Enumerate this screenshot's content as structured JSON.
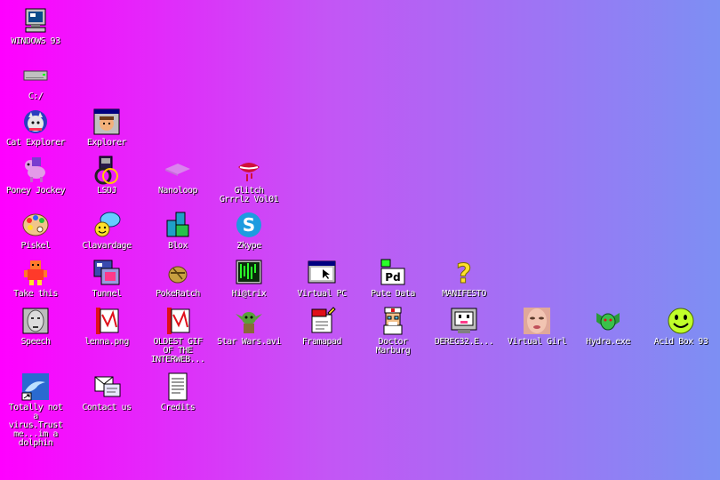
{
  "desktop": {
    "icons": [
      {
        "label": "WINDOWS 93",
        "icon": "computer-icon"
      },
      {
        "label": "C:/",
        "icon": "drive-icon"
      },
      {
        "label": "Cat Explorer",
        "icon": "cat-explorer-icon"
      },
      {
        "label": "Explorer",
        "icon": "explorer-icon"
      },
      {
        "label": "Poney Jockey",
        "icon": "pony-icon"
      },
      {
        "label": "LSDJ",
        "icon": "lsdj-icon"
      },
      {
        "label": "Nanoloop",
        "icon": "nanoloop-icon"
      },
      {
        "label": "Glitch Grrrlz Vol01",
        "icon": "glitch-lips-icon"
      },
      {
        "label": "Piskel",
        "icon": "palette-icon"
      },
      {
        "label": "Clavardage",
        "icon": "chat-icon"
      },
      {
        "label": "Blox",
        "icon": "blox-icon"
      },
      {
        "label": "Zkype",
        "icon": "zkype-icon"
      },
      {
        "label": "Take this",
        "icon": "pixel-character-icon"
      },
      {
        "label": "Tunnel",
        "icon": "tunnel-icon"
      },
      {
        "label": "PokeRatch",
        "icon": "poke-icon"
      },
      {
        "label": "Hi@trix",
        "icon": "matrix-icon"
      },
      {
        "label": "Virtual PC",
        "icon": "virtual-pc-icon"
      },
      {
        "label": "Pute Data",
        "icon": "pure-data-icon"
      },
      {
        "label": "MANIFESTO",
        "icon": "question-mark-icon"
      },
      {
        "label": "Speech",
        "icon": "face-speech-icon"
      },
      {
        "label": "lenna.png",
        "icon": "image-file-icon"
      },
      {
        "label": "OLDEST GIF OF THE INTERWEB...",
        "icon": "gif-file-icon"
      },
      {
        "label": "Star Wars.avi",
        "icon": "yoda-icon"
      },
      {
        "label": "Framapad",
        "icon": "framapad-icon"
      },
      {
        "label": "Doctor Marburg",
        "icon": "doctor-icon"
      },
      {
        "label": "DEREG32.E...",
        "icon": "dereg-icon"
      },
      {
        "label": "Virtual Girl",
        "icon": "virtual-girl-icon"
      },
      {
        "label": "Hydra.exe",
        "icon": "hydra-icon"
      },
      {
        "label": "Acid Box 93",
        "icon": "smiley-icon"
      },
      {
        "label": "Totally not a virus.Trust me...im a dolphin",
        "icon": "dolphin-icon"
      },
      {
        "label": "Contact us",
        "icon": "contact-icon"
      },
      {
        "label": "Credits",
        "icon": "credits-icon"
      }
    ]
  }
}
